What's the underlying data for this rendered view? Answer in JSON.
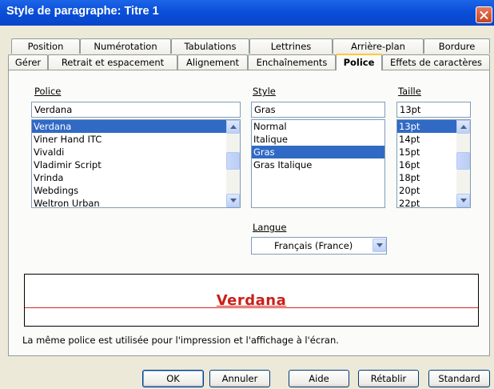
{
  "window": {
    "title": "Style de paragraphe: Titre 1"
  },
  "tabs": {
    "row1": [
      "Position",
      "Numérotation",
      "Tabulations",
      "Lettrines",
      "Arrière-plan",
      "Bordure"
    ],
    "row2": [
      "Gérer",
      "Retrait et espacement",
      "Alignement",
      "Enchaînements",
      "Police",
      "Effets de caractères"
    ],
    "active": "Police"
  },
  "font": {
    "label": "Police",
    "value": "Verdana",
    "options": [
      "Verdana",
      "Viner Hand ITC",
      "Vivaldi",
      "Vladimir Script",
      "Vrinda",
      "Webdings",
      "Weltron Urban"
    ],
    "selected": "Verdana"
  },
  "style": {
    "label": "Style",
    "value": "Gras",
    "options": [
      "Normal",
      "Italique",
      "Gras",
      "Gras Italique"
    ],
    "selected": "Gras"
  },
  "size": {
    "label": "Taille",
    "value": "13pt",
    "options": [
      "13pt",
      "14pt",
      "15pt",
      "16pt",
      "18pt",
      "20pt",
      "22pt"
    ],
    "selected": "13pt"
  },
  "language": {
    "label": "Langue",
    "value": "Français (France)"
  },
  "preview": {
    "text": "Verdana",
    "color": "#c8201a",
    "line_color": "#d9261c"
  },
  "info_text": "La même police est utilisée pour l'impression et l'affichage à l'écran.",
  "buttons": {
    "ok": "OK",
    "cancel": "Annuler",
    "help": "Aide",
    "reset": "Rétablir",
    "standard": "Standard"
  },
  "colors": {
    "titlebar": "#0a4fd9",
    "selection": "#316ac5",
    "tab_highlight": "#ffc83c",
    "dialog_bg": "#ece9d8"
  }
}
